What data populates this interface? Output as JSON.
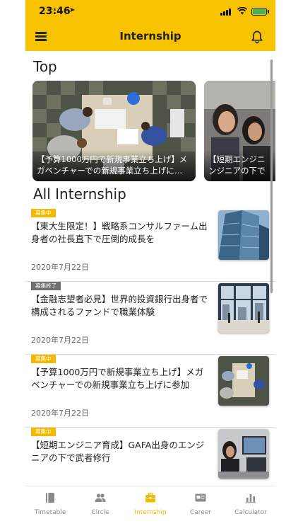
{
  "status_bar": {
    "time": "23:46"
  },
  "app_bar": {
    "title": "Internship"
  },
  "top_section": {
    "heading": "Top",
    "cards": [
      {
        "caption": "【予算1000万円で新規事業立ち上げ】メガベンチャーでの新規事業立ち上げに…"
      },
      {
        "caption": "【短期エンジニ\nンジニアの下で"
      }
    ]
  },
  "list_section": {
    "heading": "All Internship",
    "items": [
      {
        "badge": "募集中",
        "status": "open",
        "title": "【東大生限定！】戦略系コンサルファーム出身者の社長直下で圧倒的成長を",
        "date": "2020年7月22日"
      },
      {
        "badge": "募集終了",
        "status": "closed",
        "title": "【金融志望者必見】世界的投資銀行出身者で構成されるファンドで職業体験",
        "date": "2020年7月22日"
      },
      {
        "badge": "募集中",
        "status": "open",
        "title": "【予算1000万円で新規事業立ち上げ】メガベンチャーでの新規事業立ち上げに参加",
        "date": "2020年7月22日"
      },
      {
        "badge": "募集中",
        "status": "open",
        "title": "【短期エンジニア育成】GAFA出身のエンジニアの下で武者修行",
        "date": ""
      }
    ]
  },
  "tab_bar": {
    "tabs": [
      {
        "label": "Timetable",
        "icon": "book-icon"
      },
      {
        "label": "Circle",
        "icon": "people-icon"
      },
      {
        "label": "Internship",
        "icon": "briefcase-icon",
        "active": true
      },
      {
        "label": "Career",
        "icon": "id-card-icon"
      },
      {
        "label": "Calculator",
        "icon": "bar-chart-icon"
      }
    ]
  },
  "colors": {
    "accent": "#f7c200",
    "badge_open": "#f5b800",
    "badge_closed": "#707070"
  }
}
